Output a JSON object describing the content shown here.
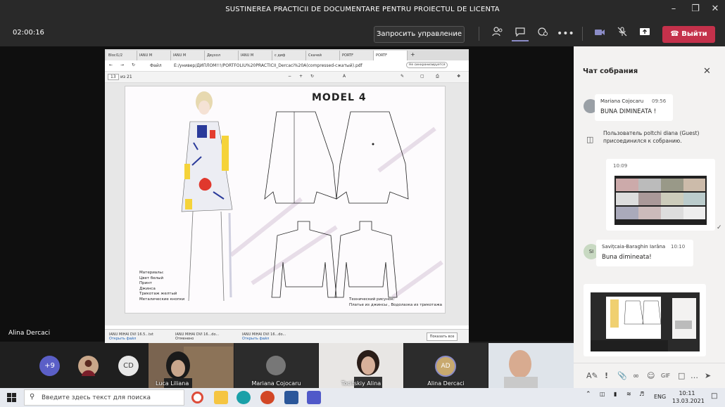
{
  "window": {
    "title": "SUSTINEREA PRACTICII DE DOCUMENTARE PENTRU PROIECTUL DE LICENTA"
  },
  "toolbar": {
    "timer": "02:00:16",
    "request_control_label": "Запросить управление",
    "leave_label": "Выйти",
    "leave_color": "#c4314b"
  },
  "stage": {
    "presenter_name": "Alina Dercaci"
  },
  "browser": {
    "tabs": [
      "Blocl1/2",
      "IANU M",
      "IANU M",
      "Двухол",
      "IANU M",
      "с диф",
      "Скачей",
      "PORTF",
      "PORTF"
    ],
    "address_label": "Файл",
    "address": "E:/универ/ДИПЛОМ!!!/PORTFOLIU%20PRACTICII_Dercaci%20A(compressed-сжатый).pdf",
    "sync_label": "Не синхронизируется",
    "page_number": "13",
    "page_total": "из 21",
    "downloads": [
      {
        "name": "IANU MIHAI DVI 16.5...txt",
        "action": "Открыть файл"
      },
      {
        "name": "IANU MIHAI DVI 16...do...",
        "action": "Отменено"
      },
      {
        "name": "IANU MIHAI DVI 16...do...",
        "action": "Открыть файл"
      }
    ],
    "show_all_label": "Показать все"
  },
  "pdf": {
    "model_title": "MODEL 4",
    "materials_heading": "Материалы:",
    "materials": [
      "Цвет белый",
      "Принт",
      "Джинса",
      "Трикотаж желтый",
      "Металические кнопки"
    ],
    "tech_heading": "Технический рисунок:",
    "tech_desc": "Платье из джинсы , Водолазка  из трикотажа"
  },
  "participants": {
    "overflow_count": "+9",
    "initials_cd": "CD",
    "tiles": [
      {
        "name": "Luca Liliana"
      },
      {
        "name": "Mariana Cojocaru"
      },
      {
        "name": "Tocitskiy Alina"
      },
      {
        "name": "Alina Dercaci",
        "initials": "AD"
      },
      {
        "name": ""
      }
    ]
  },
  "chat": {
    "title": "Чат собрания",
    "messages": [
      {
        "author": "Mariana Cojocaru",
        "time": "09:56",
        "text": "BUNA DIMINEATA !"
      },
      {
        "time": "10:09"
      },
      {
        "author": "Savițcaia-Baraghin Iarâna",
        "time": "10:10",
        "text": "Buna dimineata!",
        "initials": "SI"
      }
    ],
    "system_message": "Пользователь poltchi diana (Guest) присоединился к собранию."
  },
  "taskbar": {
    "search_placeholder": "Введите здесь текст для поиска",
    "language": "ENG",
    "time": "10:11",
    "date": "13.03.2021"
  }
}
